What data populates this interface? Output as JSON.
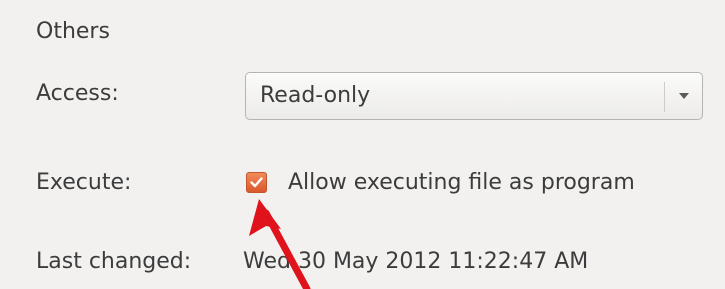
{
  "section": {
    "title": "Others"
  },
  "access": {
    "label": "Access:",
    "value": "Read-only",
    "icon": "chevron-down-icon"
  },
  "execute": {
    "label": "Execute:",
    "checkbox_label": "Allow executing file as program",
    "checked": true,
    "accent_color": "#e8693a"
  },
  "last_changed": {
    "label": "Last changed:",
    "value": "Wed 30 May 2012 11:22:47 AM"
  },
  "annotation": {
    "icon": "red-arrow-icon",
    "color": "#e0121b"
  }
}
